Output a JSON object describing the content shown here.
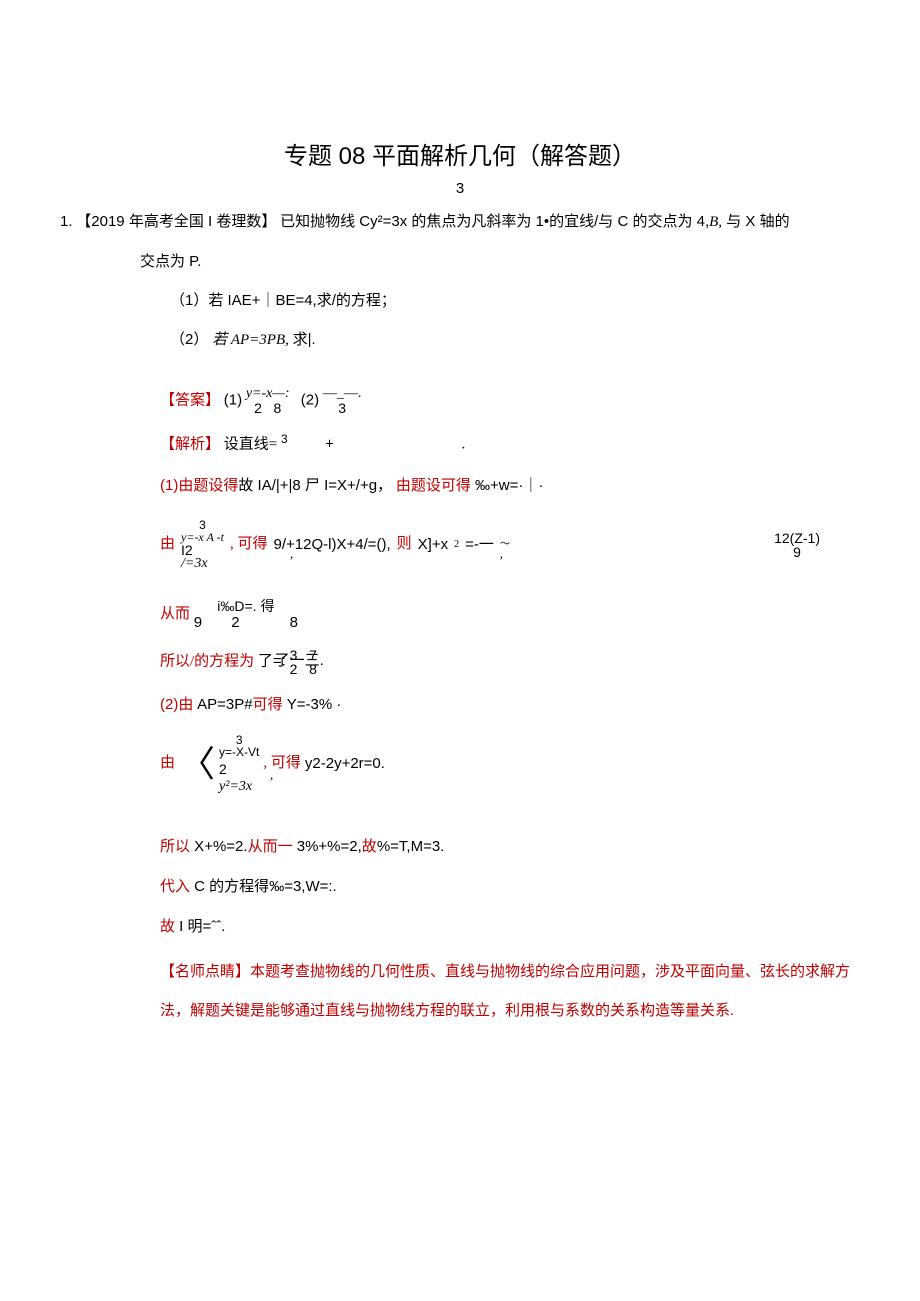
{
  "title": "专题 08 平面解析几何（解答题）",
  "title_sub": "3",
  "question": {
    "index": "1.",
    "source_bracket_open": "【",
    "source": "2019 年高考全国 I 卷理数",
    "source_bracket_close": "】",
    "stem_a": "已知抛物线 Cy²=3x 的焦点为凡斜率为 1•的宜线/与 C 的交点为 4,",
    "stem_b": "B,",
    "stem_c": " 与 X 轴的",
    "stem_line2": "交点为 P.",
    "part1": "（1）若 IAE+｜BE=4,求/的方程；",
    "part2_a": "（2）",
    "part2_b": "若",
    "part2_c": " AP=3PB,",
    "part2_d": " 求|."
  },
  "answer": {
    "label": "【答案】",
    "p1a": "(1)",
    "p1b": "y=-x—:",
    "p1_row2": "2   8",
    "p2a": "(2)",
    "p2b": "—_—.",
    "p2_row2": "3"
  },
  "analysis": {
    "label": "【解析】",
    "setup_a": "设直线=",
    "setup_sys_top": "3",
    "setup_b": "+",
    "setup_c": ",",
    "setup_d": "."
  },
  "step1": {
    "a": "(1)",
    "b": "由题设得",
    "c": "故 IA/|+|8 尸 I=X+/+g，",
    "d": "由题设可得",
    "e": " ‰+w=·｜·"
  },
  "sys1": {
    "lead": "由",
    "brace": "{",
    "top_a": "3",
    "top_b": "y=-x A -t",
    "bot_a": "I2",
    "bot_b": "/=3x",
    "mid": ", 可得",
    "eq": " 9/+12Q-l)X+4/=(),",
    "then": "则",
    "rhs1": " X]+x",
    "sub2": "2",
    "rhs2": "=-一",
    "circ": "～",
    "frac_top": "12(Z-1)",
    "frac_bot": "9",
    "comma1": ",",
    "comma2": ","
  },
  "from": {
    "a": "从而",
    "b": " i‰D=.",
    "c": " 得",
    "row2": "9       2            8"
  },
  "therefore": {
    "a": "所以/的方程为",
    "b": "了=:",
    "top": "3   7",
    "bot": "2   8",
    "c": "了一三."
  },
  "step2": {
    "a": "(2)",
    "b": "由",
    "c": " AP=3P#",
    "d": "可得",
    "e": " Y=-3% ·"
  },
  "sys2": {
    "lead": "由",
    "brace": "〈",
    "top_a": "3",
    "top_b": "y=-X-Vt",
    "mid_line": "2",
    "bot": "y²=3x",
    "tail": ", 可得",
    "eq": " y2-2y+2r=0.",
    "comma": ","
  },
  "line_a": {
    "a": "所以",
    "b": " X+%=2.",
    "c": "从而一",
    "d": " 3%+%=2,",
    "e": "故",
    "f": "%=T,M=3."
  },
  "line_b": {
    "a": "代入",
    "b": " C 的方程得",
    "c": "‰=3,W=:."
  },
  "line_c": {
    "a": "故",
    "b": " I 明=ˆˆ."
  },
  "commentary": {
    "label": "【名师点睛】",
    "text1": "本题考查抛物线的几何性质、直线与抛物线的综合应用问题，涉及平面向量、弦长的求解方",
    "text2": "法，解题关键是能够通过直线与抛物线方程的联立，利用根与系数的关系构造等量关系."
  }
}
